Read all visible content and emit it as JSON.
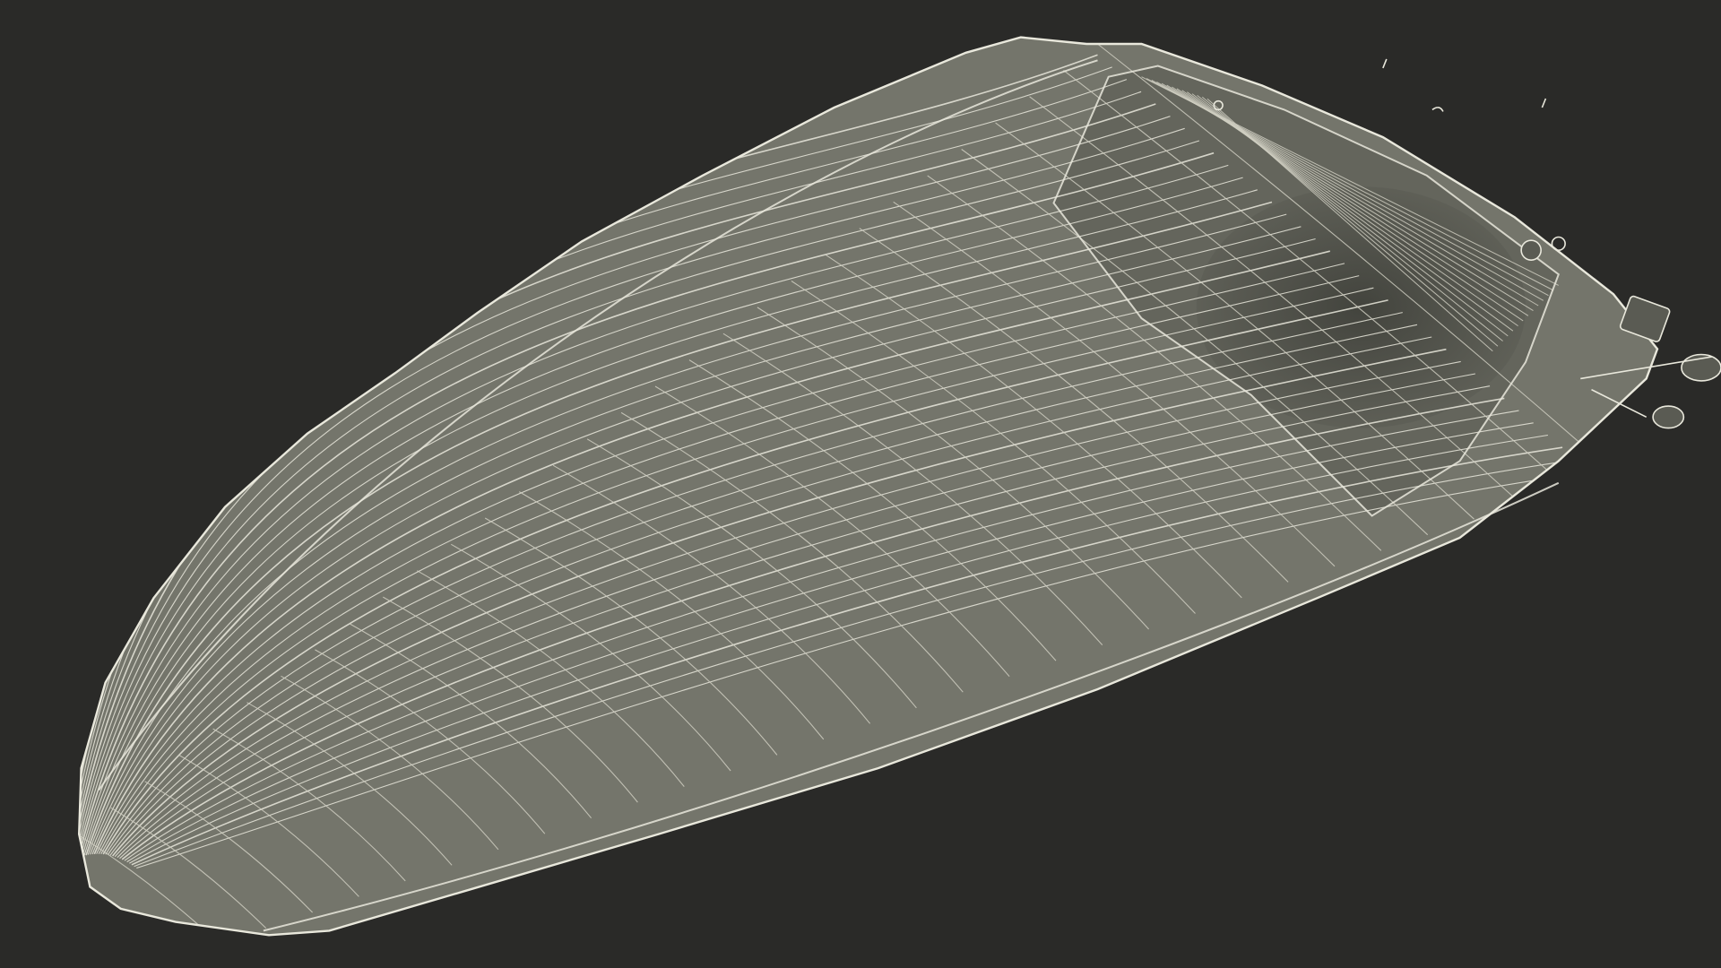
{
  "scene": {
    "subject": "boat-hull-wireframe",
    "colors": {
      "background": "#2a2a28",
      "hull_fill": "#74756b",
      "hull_fill_dark": "#64655c",
      "transom_shadow": "#4a4b44",
      "wire": "#e9e8dc",
      "wire_dim": "#cfcec1"
    }
  }
}
